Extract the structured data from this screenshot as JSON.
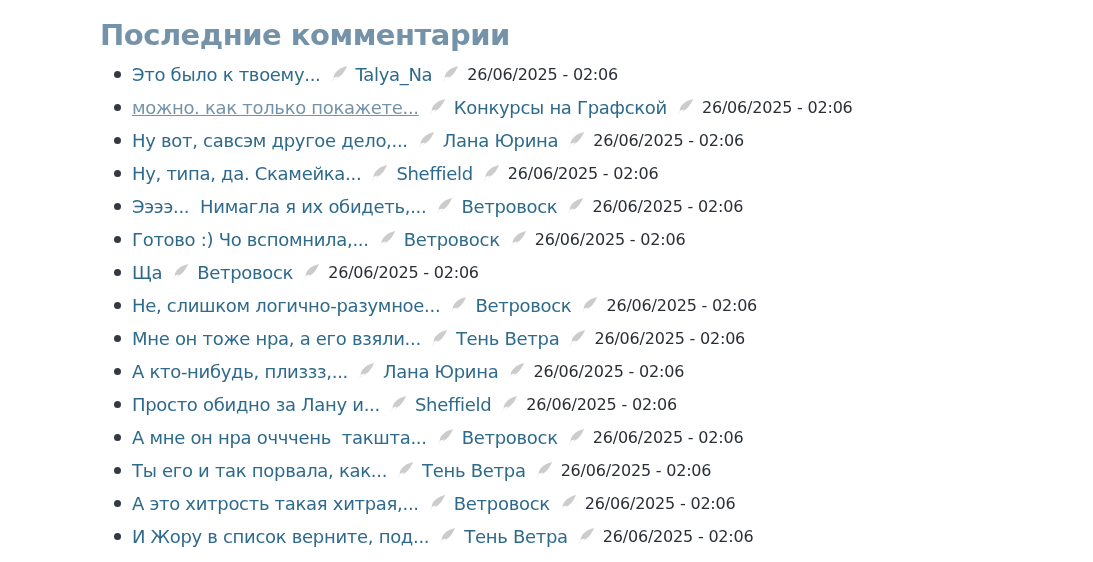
{
  "title": "Последние комментарии",
  "comments": [
    {
      "text": "Это было к твоему...",
      "author": "Talya_Na",
      "date": "26/06/2025 - 02:06",
      "hovered": false
    },
    {
      "text": "можно. как только покажете...",
      "author": "Конкурсы на Графской",
      "date": "26/06/2025 - 02:06",
      "hovered": true
    },
    {
      "text": "Ну вот, савсэм другое дело,...",
      "author": "Лана Юрина",
      "date": "26/06/2025 - 02:06",
      "hovered": false
    },
    {
      "text": "Ну, типа, да. Скамейка...",
      "author": "Sheffield",
      "date": "26/06/2025 - 02:06",
      "hovered": false
    },
    {
      "text": "Ээээ...  Нимагла я их обидеть,...",
      "author": "Ветровоск",
      "date": "26/06/2025 - 02:06",
      "hovered": false
    },
    {
      "text": "Готово :) Чо вспомнила,...",
      "author": "Ветровоск",
      "date": "26/06/2025 - 02:06",
      "hovered": false
    },
    {
      "text": "Ща",
      "author": "Ветровоск",
      "date": "26/06/2025 - 02:06",
      "hovered": false
    },
    {
      "text": "Не, слишком логично-разумное...",
      "author": "Ветровоск",
      "date": "26/06/2025 - 02:06",
      "hovered": false
    },
    {
      "text": "Мне он тоже нра, а его взяли...",
      "author": "Тень Ветра",
      "date": "26/06/2025 - 02:06",
      "hovered": false
    },
    {
      "text": "А кто-нибудь, плиззз,...",
      "author": "Лана Юрина",
      "date": "26/06/2025 - 02:06",
      "hovered": false
    },
    {
      "text": "Просто обидно за Лану и...",
      "author": "Sheffield",
      "date": "26/06/2025 - 02:06",
      "hovered": false
    },
    {
      "text": "А мне он нра очччень  такшта...",
      "author": "Ветровоск",
      "date": "26/06/2025 - 02:06",
      "hovered": false
    },
    {
      "text": "Ты его и так порвала, как...",
      "author": "Тень Ветра",
      "date": "26/06/2025 - 02:06",
      "hovered": false
    },
    {
      "text": "А это хитрость такая хитрая,...",
      "author": "Ветровоск",
      "date": "26/06/2025 - 02:06",
      "hovered": false
    },
    {
      "text": "И Жору в список верните, под...",
      "author": "Тень Ветра",
      "date": "26/06/2025 - 02:06",
      "hovered": false
    }
  ]
}
